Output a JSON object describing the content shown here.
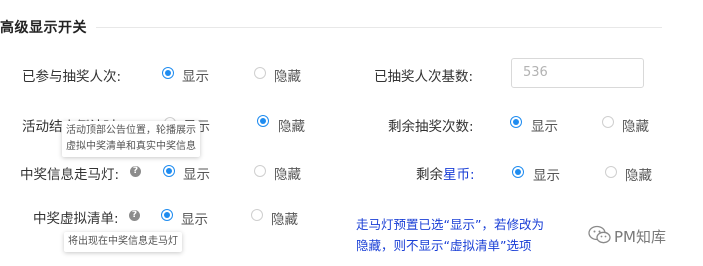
{
  "section": {
    "title": "高级显示开关"
  },
  "options": {
    "show": "显示",
    "hide": "隐藏"
  },
  "rows": {
    "participants": {
      "label": "已参与抽奖人次:",
      "selected": "显示"
    },
    "drawn_base": {
      "label": "已抽奖人次基数:",
      "value": "536"
    },
    "countdown": {
      "label": "活动结束倒计时:",
      "selected": "隐藏"
    },
    "remaining": {
      "label": "剩余抽奖次数:",
      "selected": "显示"
    },
    "marquee": {
      "label": "中奖信息走马灯:",
      "selected": "显示"
    },
    "coins": {
      "label_prefix": "剩余",
      "label_accent": "星币:",
      "selected": "显示"
    },
    "virtual_list": {
      "label": "中奖虚拟清单:",
      "selected": "显示"
    }
  },
  "tooltips": {
    "countdown_tip": [
      "活动顶部公告位置，轮播展示",
      "虚拟中奖清单和真实中奖信息"
    ],
    "virtual_tip": "将出现在中奖信息走马灯"
  },
  "note": {
    "lines": [
      "走马灯预置已选“显示”，若修改为",
      "隐藏，则不显示“虚拟清单”选项"
    ]
  },
  "watermark": {
    "text": "PM知库",
    "icon": "wechat-icon"
  },
  "colors": {
    "primary": "#1f8cf0",
    "note": "#1a3fd6"
  }
}
